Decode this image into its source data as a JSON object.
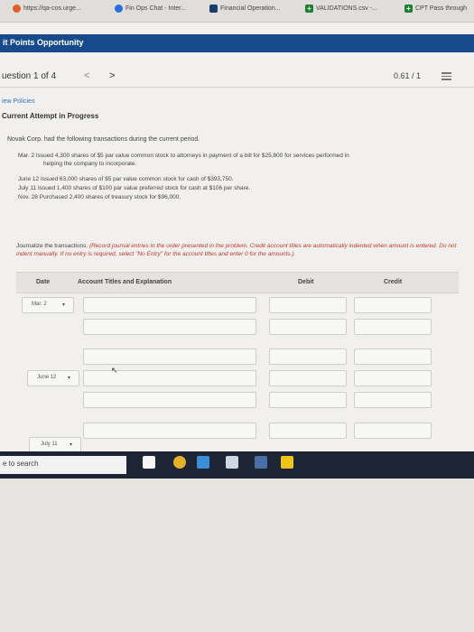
{
  "browser": {
    "tabs": [
      {
        "label": "https://qa-cos.urge..."
      },
      {
        "label": "Fin Ops Chat - Inter..."
      },
      {
        "label": "Financial Operation..."
      },
      {
        "label": "VALIDATIONS.csv -..."
      },
      {
        "label": "CPT Pass through"
      }
    ]
  },
  "header": {
    "title": "it Points Opportunity"
  },
  "question_bar": {
    "label": "uestion 1 of 4",
    "prev": "<",
    "next": ">",
    "score": "0.61 / 1"
  },
  "view_policies": "iew Policies",
  "attempt": "Current Attempt in Progress",
  "problem": "Novak Corp. had the following transactions during the current period.",
  "transactions": [
    {
      "date": "Mar.   2",
      "text": "Issued 4,300 shares of $5 par value common stock to attorneys in payment of a bill for $25,800 for services performed in",
      "text2": "helping the company to incorporate."
    },
    {
      "date": "June 12",
      "text": "Issued 63,000 shares of $5 par value common stock for cash of $393,750.",
      "text2": ""
    },
    {
      "date": "July  11",
      "text": "Issued 1,400 shares of $100 par value preferred stock for cash at $106 per share.",
      "text2": ""
    },
    {
      "date": "Nov. 28",
      "text": "Purchased 2,400 shares of treasury stock for $96,000.",
      "text2": ""
    }
  ],
  "instructions": {
    "plain": "Journalize the transactions.",
    "red": "(Record journal entries in the order presented in the problem. Credit account titles are automatically indented when amount is entered. Do not indent manually. If no entry is required, select \"No Entry\" for the account titles and enter 0 for the amounts.)"
  },
  "table": {
    "headers": {
      "date": "Date",
      "account": "Account Titles and Explanation",
      "debit": "Debit",
      "credit": "Credit"
    },
    "row_dates": [
      "Mar. 2",
      "June 12",
      "July 11"
    ]
  },
  "taskbar": {
    "search_text": "e to search"
  }
}
